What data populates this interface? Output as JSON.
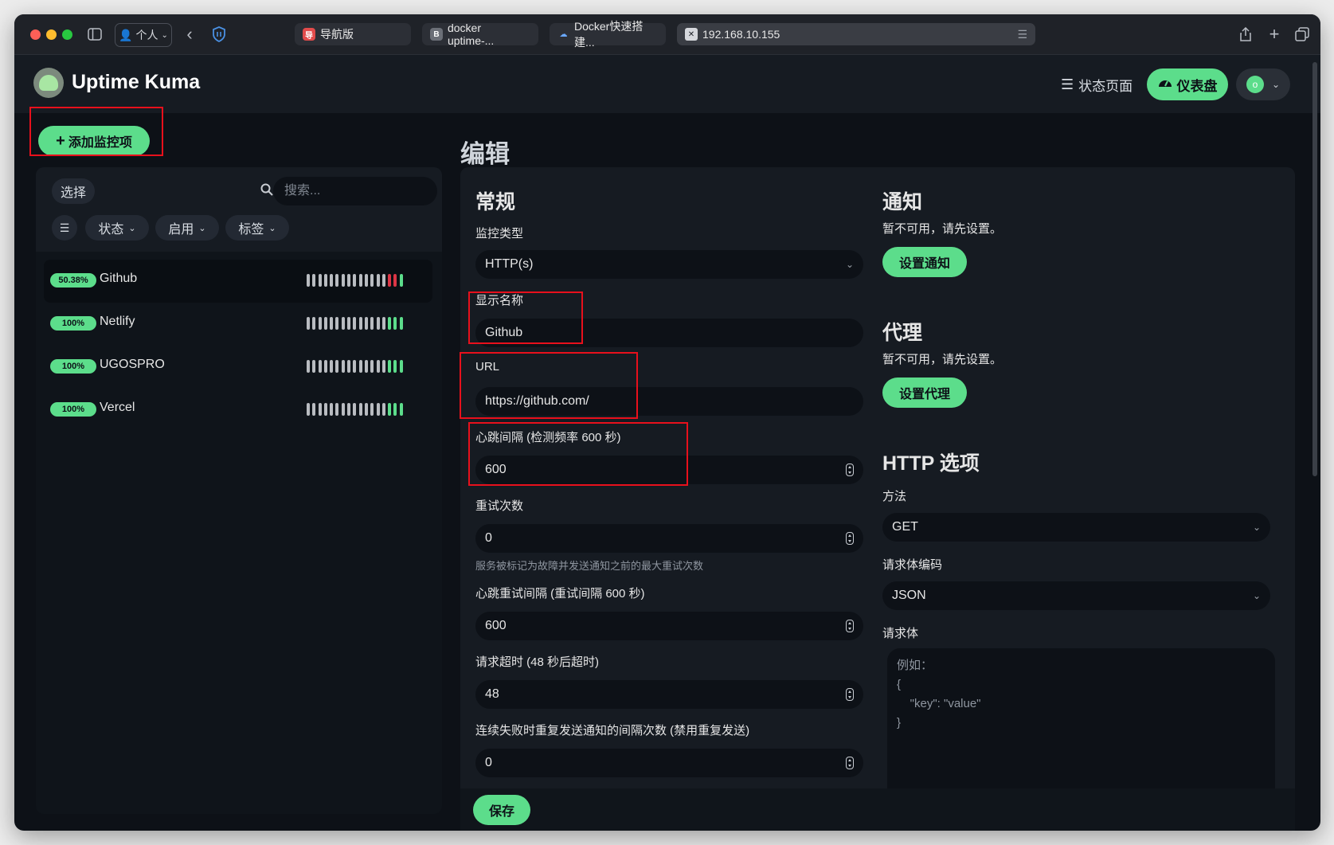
{
  "browser": {
    "profile_label": "个人",
    "tabs": [
      {
        "label": "导航版",
        "fav": "导",
        "fav_color": "#e24b4b"
      },
      {
        "label": "docker uptime-...",
        "fav": "B",
        "fav_color": "#6b6f77"
      },
      {
        "label": "Docker快速搭建...",
        "fav": "☁",
        "fav_color": "#3a3d44"
      },
      {
        "label": "192.168.10.155",
        "fav": "✕",
        "fav_color": "#3a3d44"
      }
    ]
  },
  "header": {
    "app_title": "Uptime Kuma",
    "status_page_label": "状态页面",
    "dashboard_label": "仪表盘",
    "avatar_letter": "o"
  },
  "sidebar": {
    "add_monitor_label": "添加监控项",
    "select_label": "选择",
    "search_placeholder": "搜索...",
    "filters": [
      "状态",
      "启用",
      "标签"
    ],
    "monitors": [
      {
        "uptime": "50.38%",
        "name": "Github",
        "beats": [
          "n",
          "n",
          "n",
          "n",
          "n",
          "n",
          "n",
          "n",
          "n",
          "n",
          "n",
          "n",
          "n",
          "n",
          "d",
          "d",
          "u"
        ]
      },
      {
        "uptime": "100%",
        "name": "Netlify",
        "beats": [
          "n",
          "n",
          "n",
          "n",
          "n",
          "n",
          "n",
          "n",
          "n",
          "n",
          "n",
          "n",
          "n",
          "n",
          "u",
          "u",
          "u"
        ]
      },
      {
        "uptime": "100%",
        "name": "UGOSPRO",
        "beats": [
          "n",
          "n",
          "n",
          "n",
          "n",
          "n",
          "n",
          "n",
          "n",
          "n",
          "n",
          "n",
          "n",
          "n",
          "u",
          "u",
          "u"
        ]
      },
      {
        "uptime": "100%",
        "name": "Vercel",
        "beats": [
          "n",
          "n",
          "n",
          "n",
          "n",
          "n",
          "n",
          "n",
          "n",
          "n",
          "n",
          "n",
          "n",
          "n",
          "u",
          "u",
          "u"
        ]
      }
    ]
  },
  "edit": {
    "page_title": "编辑",
    "general": {
      "heading": "常规",
      "monitor_type_label": "监控类型",
      "monitor_type_value": "HTTP(s)",
      "friendly_name_label": "显示名称",
      "friendly_name_value": "Github",
      "url_label": "URL",
      "url_value": "https://github.com/",
      "interval_label": "心跳间隔 (检测频率 600 秒)",
      "interval_value": "600",
      "retries_label": "重试次数",
      "retries_value": "0",
      "retries_hint": "服务被标记为故障并发送通知之前的最大重试次数",
      "retry_interval_label": "心跳重试间隔 (重试间隔 600 秒)",
      "retry_interval_value": "600",
      "timeout_label": "请求超时 (48 秒后超时)",
      "timeout_value": "48",
      "resend_label": "连续失败时重复发送通知的间隔次数 (禁用重复发送)",
      "resend_value": "0"
    },
    "notifications": {
      "heading": "通知",
      "unavailable_text": "暂不可用，请先设置。",
      "setup_label": "设置通知"
    },
    "proxy": {
      "heading": "代理",
      "unavailable_text": "暂不可用，请先设置。",
      "setup_label": "设置代理"
    },
    "http_options": {
      "heading": "HTTP 选项",
      "method_label": "方法",
      "method_value": "GET",
      "body_encoding_label": "请求体编码",
      "body_encoding_value": "JSON",
      "body_label": "请求体",
      "body_placeholder": "例如：\n{\n    \"key\": \"value\"\n}"
    },
    "save_label": "保存"
  },
  "colors": {
    "accent": "#5cdd8b",
    "down": "#dc3545",
    "highlight": "#e8101c"
  }
}
